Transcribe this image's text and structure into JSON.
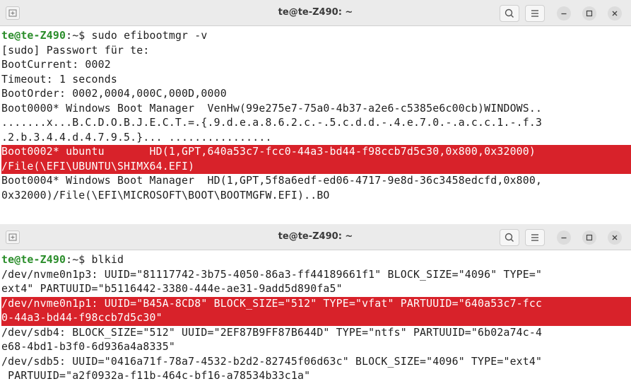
{
  "colors": {
    "prompt_user": "#2a8d2a",
    "highlight_bg": "#d8222a",
    "highlight_fg": "#ffffff",
    "titlebar_bg": "#ebebeb"
  },
  "windows": [
    {
      "title": "te@te-Z490: ~",
      "icons": [
        "new-tab-icon",
        "search-icon",
        "hamburger-menu-icon",
        "minimize-icon",
        "maximize-icon",
        "close-icon"
      ],
      "prompt_user": "te@te-Z490",
      "prompt_rest": ":~$ ",
      "command": "sudo efibootmgr -v",
      "lines": [
        "[sudo] Passwort für te:",
        "BootCurrent: 0002",
        "Timeout: 1 seconds",
        "BootOrder: 0002,0004,000C,000D,0000",
        "Boot0000* Windows Boot Manager  VenHw(99e275e7-75a0-4b37-a2e6-c5385e6c00cb)WINDOWS..",
        ".......x...B.C.D.O.B.J.E.C.T.=.{.9.d.e.a.8.6.2.c.-.5.c.d.d.-.4.e.7.0.-.a.c.c.1.-.f.3",
        ".2.b.3.4.4.d.4.7.9.5.}... ................",
        "Boot0002* ubuntu       HD(1,GPT,640a53c7-fcc0-44a3-bd44-f98ccb7d5c30,0x800,0x32000)",
        "/File(\\EFI\\UBUNTU\\SHIMX64.EFI)",
        "Boot0004* Windows Boot Manager  HD(1,GPT,5f8a6edf-ed06-4717-9e8d-36c3458edcfd,0x800,",
        "0x32000)/File(\\EFI\\MICROSOFT\\BOOT\\BOOTMGFW.EFI)..BO"
      ]
    },
    {
      "title": "te@te-Z490: ~",
      "icons": [
        "new-tab-icon",
        "search-icon",
        "hamburger-menu-icon",
        "minimize-icon",
        "maximize-icon",
        "close-icon"
      ],
      "prompt_user": "te@te-Z490",
      "prompt_rest": ":~$ ",
      "command": "blkid",
      "lines": [
        "/dev/nvme0n1p3: UUID=\"81117742-3b75-4050-86a3-ff44189661f1\" BLOCK_SIZE=\"4096\" TYPE=\"",
        "ext4\" PARTUUID=\"b5116442-3380-444e-ae31-9add5d890fa5\"",
        "/dev/nvme0n1p1: UUID=\"B45A-8CD8\" BLOCK_SIZE=\"512\" TYPE=\"vfat\" PARTUUID=\"640a53c7-fcc",
        "0-44a3-bd44-f98ccb7d5c30\"",
        "/dev/sdb4: BLOCK_SIZE=\"512\" UUID=\"2EF87B9FF87B644D\" TYPE=\"ntfs\" PARTUUID=\"6b02a74c-4",
        "e68-4bd1-b3f0-6d936a4a8335\"",
        "/dev/sdb5: UUID=\"0416a71f-78a7-4532-b2d2-82745f06d63c\" BLOCK_SIZE=\"4096\" TYPE=\"ext4\"",
        " PARTUUID=\"a2f0932a-f11b-464c-bf16-a78534b33c1a\""
      ]
    }
  ]
}
